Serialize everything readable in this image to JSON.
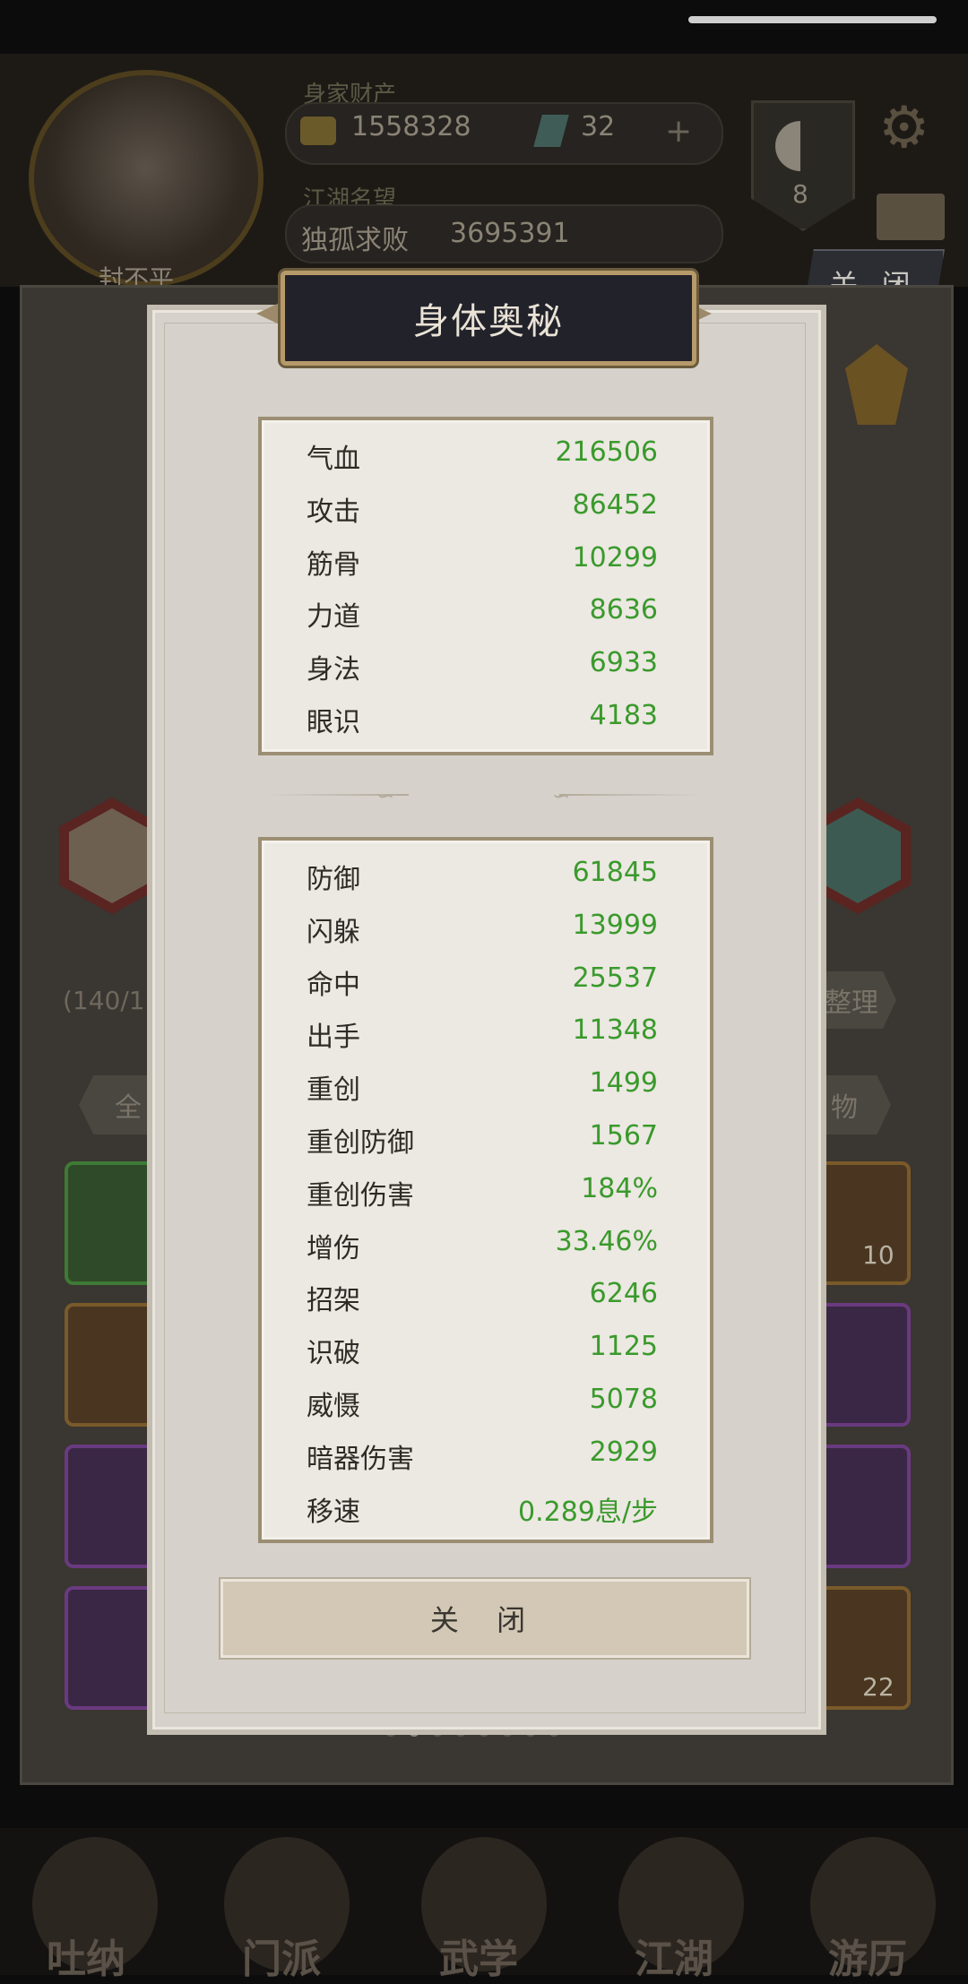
{
  "background": {
    "avatar_name": "封不平",
    "wealth_label": "身家财产",
    "gold": "1558328",
    "jade": "32",
    "plus": "+",
    "fame_label": "江湖名望",
    "fame_title": "独孤求败",
    "fame_value": "3695391",
    "taiji_level": "8",
    "close_label": "关 闭",
    "item_count": "(140/1",
    "sort_label": "整理",
    "filter_all": "全",
    "filter_item": "物",
    "slot_count_1": "10",
    "slot_count_4": "22",
    "nav": [
      "吐纳",
      "门派",
      "武学",
      "江湖",
      "游历"
    ]
  },
  "modal": {
    "title": "身体奥秘",
    "primary_stats": [
      {
        "label": "气血",
        "value": "216506"
      },
      {
        "label": "攻击",
        "value": "86452"
      },
      {
        "label": "筋骨",
        "value": "10299"
      },
      {
        "label": "力道",
        "value": "8636"
      },
      {
        "label": "身法",
        "value": "6933"
      },
      {
        "label": "眼识",
        "value": "4183"
      }
    ],
    "secondary_stats": [
      {
        "label": "防御",
        "value": "61845"
      },
      {
        "label": "闪躲",
        "value": "13999"
      },
      {
        "label": "命中",
        "value": "25537"
      },
      {
        "label": "出手",
        "value": "11348"
      },
      {
        "label": "重创",
        "value": "1499"
      },
      {
        "label": "重创防御",
        "value": "1567"
      },
      {
        "label": "重创伤害",
        "value": "184%"
      },
      {
        "label": "增伤",
        "value": "33.46%"
      },
      {
        "label": "招架",
        "value": "6246"
      },
      {
        "label": "识破",
        "value": "1125"
      },
      {
        "label": "威慑",
        "value": "5078"
      },
      {
        "label": "暗器伤害",
        "value": "2929"
      },
      {
        "label": "移速",
        "value": "0.289息/步"
      }
    ],
    "close_label": "关 闭"
  },
  "colors": {
    "stat_value": "#3a9a2c",
    "title_plate": "#22222b",
    "gold_border": "#b69a6a"
  }
}
